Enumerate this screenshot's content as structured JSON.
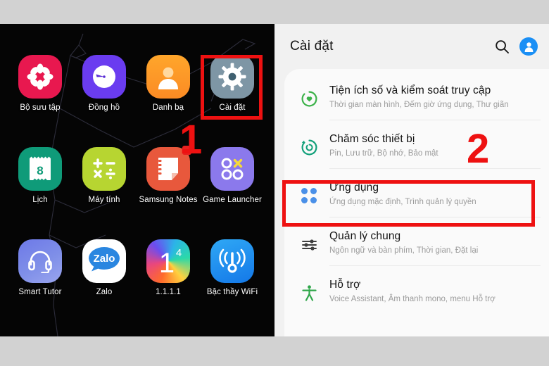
{
  "home_screen": {
    "apps": [
      {
        "label": "Bộ sưu tập",
        "icon": "gallery-icon"
      },
      {
        "label": "Đồng hồ",
        "icon": "clock-icon"
      },
      {
        "label": "Danh bạ",
        "icon": "contacts-icon"
      },
      {
        "label": "Cài đặt",
        "icon": "settings-gear-icon"
      },
      {
        "label": "Lịch",
        "icon": "calendar-icon",
        "day": "8"
      },
      {
        "label": "Máy tính",
        "icon": "calculator-icon"
      },
      {
        "label": "Samsung Notes",
        "icon": "notes-icon",
        "badge": true
      },
      {
        "label": "Game Launcher",
        "icon": "game-launcher-icon"
      },
      {
        "label": "Smart Tutor",
        "icon": "headset-icon"
      },
      {
        "label": "Zalo",
        "icon": "zalo-icon",
        "wordmark": "Zalo"
      },
      {
        "label": "1.1.1.1",
        "icon": "cloudflare-warp-icon",
        "glyph": "1",
        "sup": "4"
      },
      {
        "label": "Bậc thầy WiFi",
        "icon": "wifi-master-icon"
      }
    ]
  },
  "settings": {
    "header": {
      "title": "Cài đặt",
      "search_icon": "search-icon",
      "avatar_icon": "account-avatar-icon"
    },
    "items": [
      {
        "title": "Tiện ích số và kiểm soát truy cập",
        "subtitle": "Thời gian màn hình, Đếm giờ ứng dụng, Thư giãn",
        "icon": "digital-wellbeing-icon"
      },
      {
        "title": "Chăm sóc thiết bị",
        "subtitle": "Pin, Lưu trữ, Bộ nhớ, Bảo mật",
        "icon": "device-care-icon"
      },
      {
        "title": "Ứng dụng",
        "subtitle": "Ứng dụng mặc định, Trình quản lý quyền",
        "icon": "apps-dots-icon",
        "highlighted": true
      },
      {
        "title": "Quản lý chung",
        "subtitle": "Ngôn ngữ và bàn phím, Thời gian, Đặt lại",
        "icon": "general-management-sliders-icon"
      },
      {
        "title": "Hỗ trợ",
        "subtitle": "Voice Assistant, Âm thanh mono, menu Hỗ trợ",
        "icon": "accessibility-icon"
      }
    ]
  },
  "annotations": {
    "step_one": "1",
    "step_two": "2",
    "accent_color": "#ee1111"
  }
}
